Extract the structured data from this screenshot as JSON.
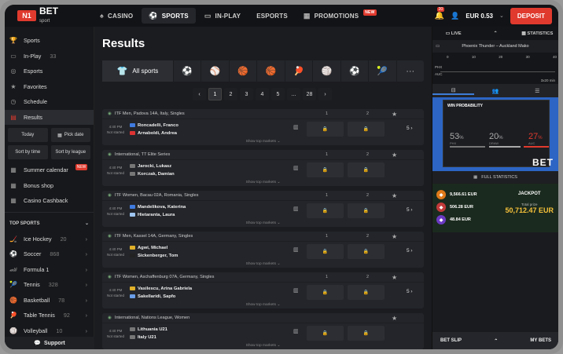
{
  "brand": {
    "logo_mark": "N1",
    "name": "BET",
    "sub": "sport"
  },
  "topnav": [
    {
      "label": "CASINO",
      "icon": "casino-icon",
      "glyph": "♠"
    },
    {
      "label": "SPORTS",
      "icon": "sports-icon",
      "glyph": "⚽"
    },
    {
      "label": "IN-PLAY",
      "icon": "inplay-icon",
      "glyph": "▭"
    },
    {
      "label": "ESPORTS",
      "icon": "",
      "glyph": ""
    },
    {
      "label": "PROMOTIONS",
      "icon": "gift-icon",
      "glyph": "▦",
      "badge": "NEW"
    }
  ],
  "header": {
    "notif_count": "20",
    "balance": "EUR 0.53",
    "deposit": "DEPOSIT"
  },
  "sidebar": {
    "items": [
      {
        "label": "Sports",
        "icon": "trophy-icon",
        "glyph": "🏆",
        "count": ""
      },
      {
        "label": "In-Play",
        "icon": "tv-icon",
        "glyph": "▭",
        "count": "33"
      },
      {
        "label": "Esports",
        "icon": "gamepad-icon",
        "glyph": "◎",
        "count": ""
      },
      {
        "label": "Favorites",
        "icon": "star-icon",
        "glyph": "★",
        "count": ""
      },
      {
        "label": "Schedule",
        "icon": "clock-icon",
        "glyph": "◷",
        "count": ""
      },
      {
        "label": "Results",
        "icon": "list-icon",
        "glyph": "▤",
        "count": ""
      }
    ],
    "today": "Today",
    "pick_date": "Pick date",
    "sort_time": "Sort by time",
    "sort_league": "Sort by league",
    "promos": [
      {
        "label": "Summer calendar",
        "badge": "NEW"
      },
      {
        "label": "Bonus shop"
      },
      {
        "label": "Casino Cashback"
      }
    ],
    "top_sports_title": "TOP SPORTS",
    "top_sports": [
      {
        "label": "Ice Hockey",
        "count": "20"
      },
      {
        "label": "Soccer",
        "count": "868"
      },
      {
        "label": "Formula 1",
        "count": ""
      },
      {
        "label": "Tennis",
        "count": "328"
      },
      {
        "label": "Basketball",
        "count": "78"
      },
      {
        "label": "Table Tennis",
        "count": "92"
      },
      {
        "label": "Volleyball",
        "count": "10"
      }
    ],
    "support": "Support"
  },
  "main": {
    "title": "Results",
    "all_sports": "All sports",
    "sport_icons": [
      "⚽",
      "⚾",
      "🏀",
      "🏀",
      "🏓",
      "🏐",
      "⚽",
      "🎾",
      "···"
    ],
    "pager": [
      "‹",
      "1",
      "2",
      "3",
      "4",
      "5",
      "...",
      "28",
      "›"
    ],
    "show_top": "Show top markets ⌄",
    "events": [
      {
        "league": "ITF Men, Padova 14A, Italy, Singles",
        "time": "4:40 PM",
        "status": "Not started",
        "t1": "Roncadelli, Franco",
        "t2": "Arnaboldi, Andrea",
        "f1": "#3f7be0",
        "f2": "#d33",
        "more": "5 ›",
        "c1": "1",
        "c2": "2"
      },
      {
        "league": "International, TT Elite Series",
        "time": "4:40 PM",
        "status": "Not started",
        "t1": "Jarocki, Lukasz",
        "t2": "Korczak, Damian",
        "f1": "#777",
        "f2": "#777",
        "more": "",
        "c1": "1",
        "c2": "2"
      },
      {
        "league": "ITF Women, Bacau 02A, Romania, Singles",
        "time": "4:40 PM",
        "status": "Not started",
        "t1": "Mandelikova, Katerina",
        "t2": "Hietaranta, Laura",
        "f1": "#3f7be0",
        "f2": "#9ec5f0",
        "more": "5 ›",
        "c1": "1",
        "c2": "2"
      },
      {
        "league": "ITF Men, Kassel 14A, Germany, Singles",
        "time": "4:40 PM",
        "status": "Not started",
        "t1": "Agwi, Michael",
        "t2": "Sickenberger, Tom",
        "f1": "#e0b02a",
        "f2": "#222",
        "more": "5 ›",
        "c1": "1",
        "c2": "2"
      },
      {
        "league": "ITF Women, Aschaffenburg 07A, Germany, Singles",
        "time": "4:40 PM",
        "status": "Not started",
        "t1": "Vasilescu, Arina Gabriela",
        "t2": "Sakellaridi, Sapfo",
        "f1": "#e0b02a",
        "f2": "#6a9ee8",
        "more": "5 ›",
        "c1": "1",
        "c2": "2"
      },
      {
        "league": "International, Nations League, Women",
        "time": "4:40 PM",
        "status": "Not started",
        "t1": "Lithuania U21",
        "t2": "Italy U21",
        "f1": "#777",
        "f2": "#777",
        "more": "",
        "c1": "",
        "c2": ""
      }
    ]
  },
  "right": {
    "tab_live": "LIVE",
    "tab_stats": "STATISTICS",
    "match": "Phoenix Thunder – Auckland Mako",
    "tl_nums": [
      "0",
      "10",
      "20",
      "30",
      "40"
    ],
    "tl_rows": [
      "PHX",
      "AUC"
    ],
    "tl_end": "3x20 min",
    "win_title": "WIN PROBABILITY",
    "win": [
      {
        "pct": "53",
        "label": "PHX"
      },
      {
        "pct": "20",
        "label": "DRAW"
      },
      {
        "pct": "27",
        "label": "AUC"
      }
    ],
    "watermark": "BET",
    "full_stats": "FULL STATISTICS",
    "jackpots": [
      {
        "amount": "9,566.61 EUR",
        "color": "#e07a1a"
      },
      {
        "amount": "506.28 EUR",
        "color": "#c23a3a"
      },
      {
        "amount": "48.84 EUR",
        "color": "#6a3ac2"
      }
    ],
    "jackpot_title": "JACKPOT",
    "total_prize": "Total prize",
    "jackpot_total": "50,712.47 EUR",
    "bet_slip": "BET SLIP",
    "my_bets": "MY BETS"
  }
}
